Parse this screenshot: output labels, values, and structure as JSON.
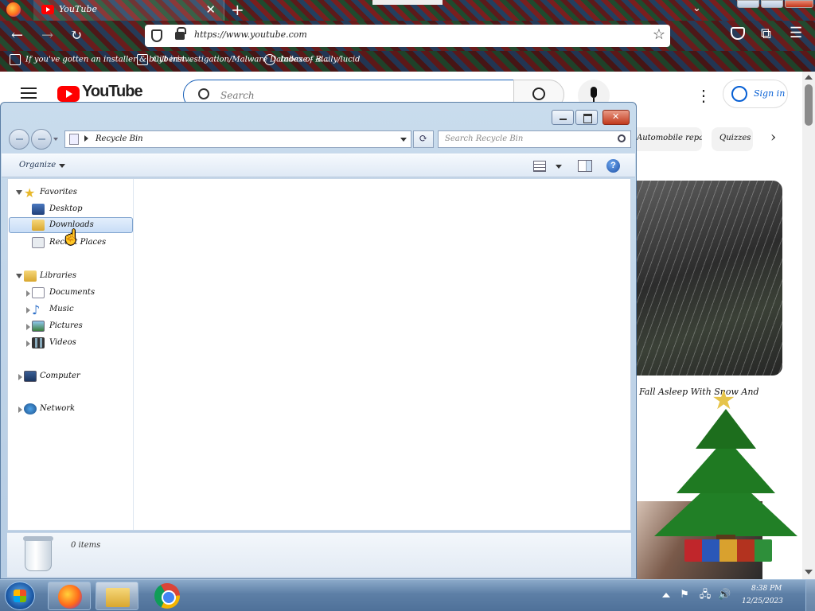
{
  "browser": {
    "tab_title": "YouTube",
    "tab_close": "✕",
    "new_tab": "+",
    "tabs_menu": "⌄",
    "url": "https://www.youtube.com",
    "back": "←",
    "forward": "→",
    "reload": "↻",
    "bookmark_star": "☆",
    "extensions": "⧉",
    "menu": "☰",
    "bookmarks": [
      {
        "label": "If you've gotten an installer & built inst...",
        "icon": "book-icon"
      },
      {
        "label": "Cyberinvestigation/Malware Database - B...",
        "icon": "page-icon"
      },
      {
        "label": "Index of -daily/lucid",
        "icon": "globe-icon"
      }
    ]
  },
  "youtube": {
    "wordmark": "YouTube",
    "search_placeholder": "Search",
    "more": "⋮",
    "sign_in": "Sign in",
    "chips": [
      "Automobile repair shops",
      "Quizzes"
    ],
    "chip_next": "›",
    "video_title": "Fall Asleep With Snow And"
  },
  "explorer": {
    "address": "Recycle Bin",
    "refresh": "⟳",
    "search_placeholder": "Search Recycle Bin",
    "organize": "Organize",
    "help": "?",
    "tree": {
      "favorites": "Favorites",
      "desktop": "Desktop",
      "downloads": "Downloads",
      "recent_places": "Recent Places",
      "libraries": "Libraries",
      "documents": "Documents",
      "music": "Music",
      "pictures": "Pictures",
      "videos": "Videos",
      "computer": "Computer",
      "network": "Network"
    },
    "item_count": "0 items"
  },
  "taskbar": {
    "clock_time": "8:38 PM",
    "clock_date": "12/25/2023",
    "tray_flag": "⚑",
    "tray_network": "🖧",
    "tray_volume": "🔊"
  },
  "cursor": "☝",
  "colors": {
    "youtube_red": "#ff0000",
    "explorer_frame": "#b6cce3",
    "selection": "#c8ddf6",
    "taskbar": "#5d7fa6"
  }
}
